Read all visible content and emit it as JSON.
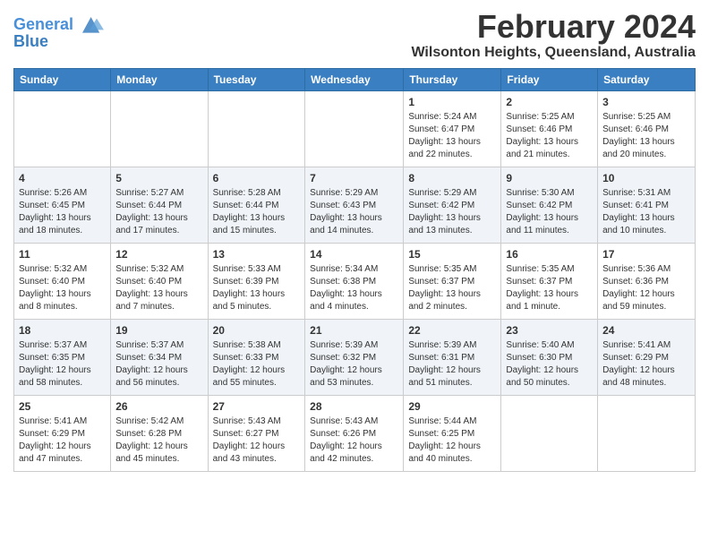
{
  "header": {
    "logo_line1": "General",
    "logo_line2": "Blue",
    "month": "February 2024",
    "location": "Wilsonton Heights, Queensland, Australia"
  },
  "days_of_week": [
    "Sunday",
    "Monday",
    "Tuesday",
    "Wednesday",
    "Thursday",
    "Friday",
    "Saturday"
  ],
  "weeks": [
    [
      {
        "day": "",
        "content": ""
      },
      {
        "day": "",
        "content": ""
      },
      {
        "day": "",
        "content": ""
      },
      {
        "day": "",
        "content": ""
      },
      {
        "day": "1",
        "content": "Sunrise: 5:24 AM\nSunset: 6:47 PM\nDaylight: 13 hours and 22 minutes."
      },
      {
        "day": "2",
        "content": "Sunrise: 5:25 AM\nSunset: 6:46 PM\nDaylight: 13 hours and 21 minutes."
      },
      {
        "day": "3",
        "content": "Sunrise: 5:25 AM\nSunset: 6:46 PM\nDaylight: 13 hours and 20 minutes."
      }
    ],
    [
      {
        "day": "4",
        "content": "Sunrise: 5:26 AM\nSunset: 6:45 PM\nDaylight: 13 hours and 18 minutes."
      },
      {
        "day": "5",
        "content": "Sunrise: 5:27 AM\nSunset: 6:44 PM\nDaylight: 13 hours and 17 minutes."
      },
      {
        "day": "6",
        "content": "Sunrise: 5:28 AM\nSunset: 6:44 PM\nDaylight: 13 hours and 15 minutes."
      },
      {
        "day": "7",
        "content": "Sunrise: 5:29 AM\nSunset: 6:43 PM\nDaylight: 13 hours and 14 minutes."
      },
      {
        "day": "8",
        "content": "Sunrise: 5:29 AM\nSunset: 6:42 PM\nDaylight: 13 hours and 13 minutes."
      },
      {
        "day": "9",
        "content": "Sunrise: 5:30 AM\nSunset: 6:42 PM\nDaylight: 13 hours and 11 minutes."
      },
      {
        "day": "10",
        "content": "Sunrise: 5:31 AM\nSunset: 6:41 PM\nDaylight: 13 hours and 10 minutes."
      }
    ],
    [
      {
        "day": "11",
        "content": "Sunrise: 5:32 AM\nSunset: 6:40 PM\nDaylight: 13 hours and 8 minutes."
      },
      {
        "day": "12",
        "content": "Sunrise: 5:32 AM\nSunset: 6:40 PM\nDaylight: 13 hours and 7 minutes."
      },
      {
        "day": "13",
        "content": "Sunrise: 5:33 AM\nSunset: 6:39 PM\nDaylight: 13 hours and 5 minutes."
      },
      {
        "day": "14",
        "content": "Sunrise: 5:34 AM\nSunset: 6:38 PM\nDaylight: 13 hours and 4 minutes."
      },
      {
        "day": "15",
        "content": "Sunrise: 5:35 AM\nSunset: 6:37 PM\nDaylight: 13 hours and 2 minutes."
      },
      {
        "day": "16",
        "content": "Sunrise: 5:35 AM\nSunset: 6:37 PM\nDaylight: 13 hours and 1 minute."
      },
      {
        "day": "17",
        "content": "Sunrise: 5:36 AM\nSunset: 6:36 PM\nDaylight: 12 hours and 59 minutes."
      }
    ],
    [
      {
        "day": "18",
        "content": "Sunrise: 5:37 AM\nSunset: 6:35 PM\nDaylight: 12 hours and 58 minutes."
      },
      {
        "day": "19",
        "content": "Sunrise: 5:37 AM\nSunset: 6:34 PM\nDaylight: 12 hours and 56 minutes."
      },
      {
        "day": "20",
        "content": "Sunrise: 5:38 AM\nSunset: 6:33 PM\nDaylight: 12 hours and 55 minutes."
      },
      {
        "day": "21",
        "content": "Sunrise: 5:39 AM\nSunset: 6:32 PM\nDaylight: 12 hours and 53 minutes."
      },
      {
        "day": "22",
        "content": "Sunrise: 5:39 AM\nSunset: 6:31 PM\nDaylight: 12 hours and 51 minutes."
      },
      {
        "day": "23",
        "content": "Sunrise: 5:40 AM\nSunset: 6:30 PM\nDaylight: 12 hours and 50 minutes."
      },
      {
        "day": "24",
        "content": "Sunrise: 5:41 AM\nSunset: 6:29 PM\nDaylight: 12 hours and 48 minutes."
      }
    ],
    [
      {
        "day": "25",
        "content": "Sunrise: 5:41 AM\nSunset: 6:29 PM\nDaylight: 12 hours and 47 minutes."
      },
      {
        "day": "26",
        "content": "Sunrise: 5:42 AM\nSunset: 6:28 PM\nDaylight: 12 hours and 45 minutes."
      },
      {
        "day": "27",
        "content": "Sunrise: 5:43 AM\nSunset: 6:27 PM\nDaylight: 12 hours and 43 minutes."
      },
      {
        "day": "28",
        "content": "Sunrise: 5:43 AM\nSunset: 6:26 PM\nDaylight: 12 hours and 42 minutes."
      },
      {
        "day": "29",
        "content": "Sunrise: 5:44 AM\nSunset: 6:25 PM\nDaylight: 12 hours and 40 minutes."
      },
      {
        "day": "",
        "content": ""
      },
      {
        "day": "",
        "content": ""
      }
    ]
  ]
}
